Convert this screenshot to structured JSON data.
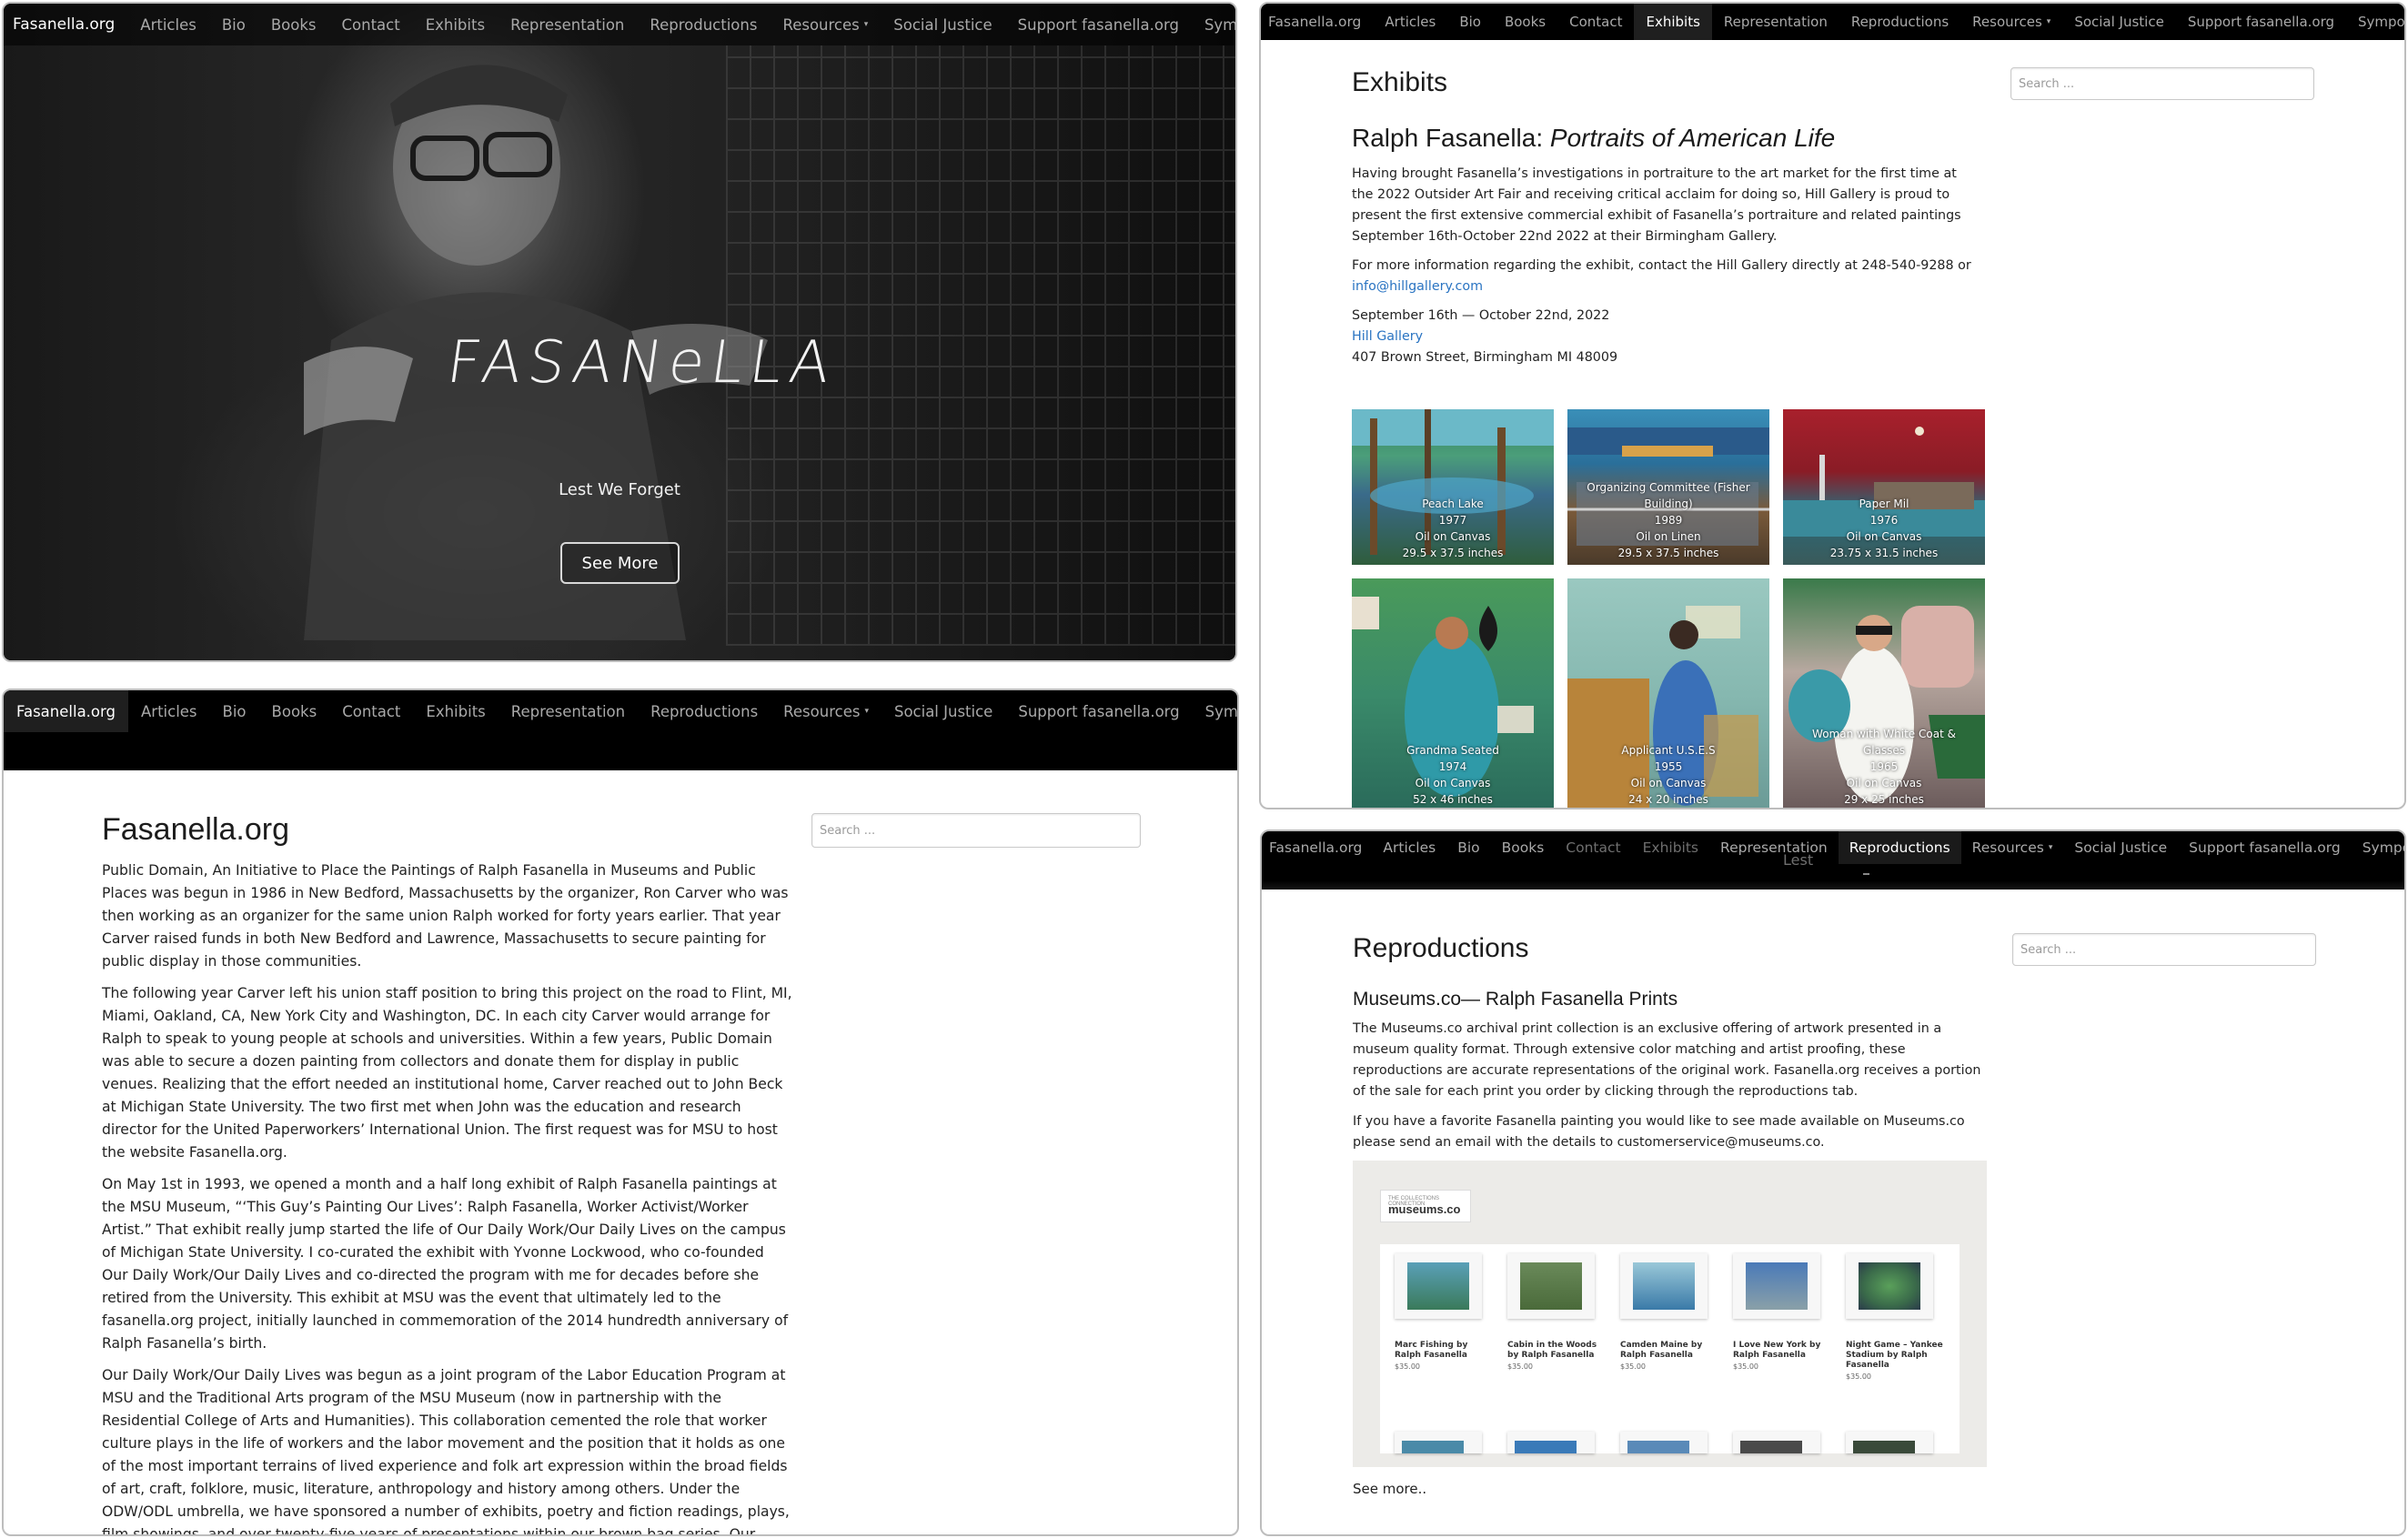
{
  "nav": {
    "brand": "Fasanella.org",
    "items": [
      "Articles",
      "Bio",
      "Books",
      "Contact",
      "Exhibits",
      "Representation",
      "Reproductions",
      "Resources",
      "Social Justice",
      "Support fasanella.org",
      "Symposium"
    ],
    "resources_caret": "▾"
  },
  "hero": {
    "logo_text": "FASANeLLA",
    "tagline": "Lest We Forget",
    "button_label": "See More"
  },
  "home": {
    "title": "Fasanella.org",
    "search_placeholder": "Search ...",
    "paragraphs": [
      "Public Domain, An Initiative to Place the Paintings of Ralph Fasanella in Museums and Public Places was begun in 1986 in New Bedford, Massachusetts by the organizer, Ron Carver who was then working as an organizer for the same union Ralph worked for forty years earlier. That year Carver raised funds in both New Bedford and Lawrence, Massachusetts to secure painting for public display in those communities.",
      "The following year Carver left his union staff position to bring this project on the road to Flint, MI, Miami, Oakland, CA, New York City and Washington, DC. In each city Carver would arrange for Ralph to speak to young people at schools and universities. Within a few years, Public Domain was able to secure a dozen painting from collectors and donate them for display in public venues. Realizing that the effort needed an institutional home, Carver reached out to John Beck at Michigan State University. The two first met when John was the education and research director for the United Paperworkers’ International Union. The first request was for MSU to host the website Fasanella.org.",
      "On May 1st in 1993, we opened a month and a half long exhibit of Ralph Fasanella paintings at the MSU Museum, “‘This Guy’s Painting Our Lives’: Ralph Fasanella, Worker Activist/Worker Artist.” That exhibit really jump started the life of Our Daily Work/Our Daily Lives on the campus of Michigan State University. I co-curated the exhibit with Yvonne Lockwood, who co-founded Our Daily Work/Our Daily Lives and co-directed the program with me for decades before she retired from the University. This exhibit at MSU was the event that ultimately led to  the fasanella.org project, initially launched in commemoration of the 2014 hundredth anniversary of Ralph Fasanella’s birth.",
      "Our Daily Work/Our Daily Lives was begun as a joint program of the Labor Education Program at MSU and the Traditional Arts program of the MSU Museum (now in partnership with the Residential College of Arts and Humanities). This collaboration cemented the role that worker culture plays in the life of workers and the labor movement and the position that it holds as one of the most important terrains of lived experience and folk art expression within the broad fields of art, craft, folklore, music, literature, anthropology and history among others. Under the ODW/ODL umbrella, we have sponsored a number of exhibits, poetry and fiction readings, plays, film showings, and over twenty-five years of presentations within our brown bag series. Our work together on Our Daily Work/Our Daily Lives earned us one of MSU’s prestigious Excellence in Diversity Awards in 2003."
    ]
  },
  "exhibits": {
    "title": "Exhibits",
    "search_placeholder": "Search ...",
    "subtitle_prefix": "Ralph Fasanella: ",
    "subtitle_italic": "Portraits of American Life",
    "para1": "Having brought Fasanella’s investigations in portraiture to the art market for the first time at the 2022 Outsider Art Fair and receiving critical acclaim for doing so, Hill Gallery is proud to present the first extensive commercial exhibit of Fasanella’s portraiture and related paintings September 16th-October 22nd 2022 at their Birmingham Gallery.",
    "para2_text": "For more information regarding the exhibit, contact the Hill Gallery directly at 248-540-9288 or ",
    "para2_link": "info@hillgallery.com",
    "dates": "September 16th — October 22nd, 2022",
    "gallery_link": "Hill Gallery",
    "address": "407 Brown Street, Birmingham MI 48009",
    "paintings": [
      {
        "title": "Peach Lake",
        "year": "1977",
        "medium": "Oil on Canvas",
        "size": "29.5 x 37.5 inches"
      },
      {
        "title": "Organizing Committee (Fisher Building)",
        "year": "1989",
        "medium": "Oil on Linen",
        "size": "29.5 x 37.5 inches"
      },
      {
        "title": "Paper Mil",
        "year": "1976",
        "medium": "Oil on Canvas",
        "size": "23.75 x 31.5 inches"
      },
      {
        "title": "Grandma Seated",
        "year": "1974",
        "medium": "Oil on Canvas",
        "size": "52 x 46 inches"
      },
      {
        "title": "Applicant U.S.E.S",
        "year": "1955",
        "medium": "Oil on Canvas",
        "size": "24 x 20 inches"
      },
      {
        "title": "Woman with White Coat & Glasses",
        "year": "1965",
        "medium": "Oil on Canvas",
        "size": "29 x 25 inches"
      }
    ]
  },
  "reproductions": {
    "ghost_text": "Lest",
    "title": "Reproductions",
    "search_placeholder": "Search ...",
    "subtitle": "Museums.co— Ralph Fasanella Prints",
    "para1": "The Museums.co archival print collection is an exclusive offering of artwork presented in a museum quality format. Through extensive color matching and artist proofing, these reproductions are accurate representations of the original work. Fasanella.org receives a portion of the sale for each print you order by clicking through the reproductions tab.",
    "para2": "If you have a favorite Fasanella painting you would like to see made available on Museums.co please send an email with the details to customerservice@museums.co.",
    "shop_logo_top": "THE COLLECTIONS CONNECTION",
    "shop_logo_name": "museums.co",
    "products": [
      {
        "title": "Marc Fishing by Ralph Fasanella",
        "price": "$35.00"
      },
      {
        "title": "Cabin in the Woods by Ralph Fasanella",
        "price": "$35.00"
      },
      {
        "title": "Camden Maine by Ralph Fasanella",
        "price": "$35.00"
      },
      {
        "title": "I Love New York by Ralph Fasanella",
        "price": "$35.00"
      },
      {
        "title": "Night Game – Yankee Stadium by Ralph Fasanella",
        "price": "$35.00"
      }
    ],
    "see_more": "See more.."
  },
  "colors": {
    "nav_bg": "#000000",
    "nav_text": "#a9a9a9",
    "link": "#2a74c2"
  }
}
